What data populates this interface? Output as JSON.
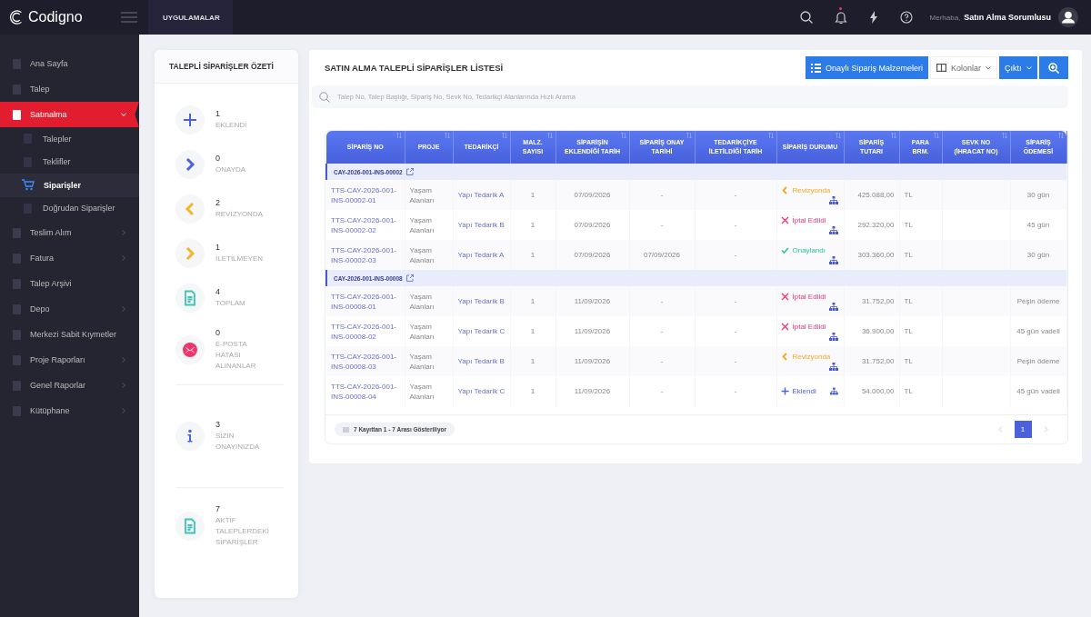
{
  "topbar": {
    "brand": "Codigno",
    "apps_label": "UYGULAMALAR",
    "greeting": "Merhaba,",
    "user_name": "Satın Alma Sorumlusu",
    "notification_dot": true
  },
  "sidebar": {
    "items": [
      {
        "label": "Ana Sayfa",
        "selected": false
      },
      {
        "label": "Talep",
        "selected": false
      },
      {
        "label": "Satınalma",
        "selected": true,
        "expanded": true,
        "children": [
          {
            "label": "Talepler",
            "selected": false
          },
          {
            "label": "Teklifler",
            "selected": false
          },
          {
            "label": "Siparişler",
            "selected": true
          },
          {
            "label": "Doğrudan Siparişler",
            "selected": false
          }
        ]
      },
      {
        "label": "Teslim Alım",
        "selected": false,
        "expanded": false
      },
      {
        "label": "Fatura",
        "selected": false,
        "expanded": false
      },
      {
        "label": "Talep Arşivi",
        "selected": false
      },
      {
        "label": "Depo",
        "selected": false,
        "expanded": false
      },
      {
        "label": "Merkezi Sabit Kıymetler",
        "selected": false
      },
      {
        "label": "Proje Raporları",
        "selected": false,
        "expanded": false
      },
      {
        "label": "Genel Raporlar",
        "selected": false,
        "expanded": false
      },
      {
        "label": "Kütüphane",
        "selected": false,
        "expanded": false
      }
    ]
  },
  "summary": {
    "title": "TALEPLİ SİPARİŞLER ÖZETİ",
    "groups": [
      [
        {
          "count": "1",
          "label": "EKLENDİ",
          "kind": "plus",
          "color": "#4a63e0"
        },
        {
          "count": "0",
          "label": "ONAYDA",
          "kind": "right",
          "color": "#4a63e0"
        },
        {
          "count": "2",
          "label": "REVİZYONDA",
          "kind": "left",
          "color": "#f5b52a"
        },
        {
          "count": "1",
          "label": "İLETİLMEYEN",
          "kind": "right",
          "color": "#f5b52a"
        },
        {
          "count": "4",
          "label": "TOPLAM",
          "kind": "doc",
          "color": "#3cc4b5"
        },
        {
          "count": "0",
          "label": "E-POSTA HATASI ALINANLAR",
          "kind": "mail",
          "color": "#f0346e"
        }
      ],
      [
        {
          "count": "3",
          "label": "SİZİN ONAYINIZDA",
          "kind": "info",
          "color": "#4a63e0"
        }
      ],
      [
        {
          "count": "7",
          "label": "AKTİF TALEPLERDEKİ SİPARİŞLER",
          "kind": "doc",
          "color": "#3cc4b5"
        }
      ]
    ]
  },
  "orders": {
    "title": "SATIN ALMA TALEPLİ SİPARİŞLER LİSTESİ",
    "buttons": [
      {
        "label": "Onaylı Sipariş Malzemeleri",
        "kind": "list"
      },
      {
        "label": "Kolonlar",
        "kind": "columns"
      },
      {
        "label": "Çıktı",
        "kind": "dropdown"
      },
      {
        "kind": "zoom"
      }
    ],
    "search": {
      "placeholder": "Talep No, Talep Başlığı, Sipariş No, Sevk No, Tedarikçi Alanlarında Hızlı Arama"
    },
    "table": {
      "columns": [
        "SİPARİŞ NO",
        "PROJE",
        "TEDARİKÇİ",
        "MALZ. SAYISI",
        "SİPARİŞİN EKLENDİĞİ TARİH",
        "SİPARİŞ ONAY TARİHİ",
        "TEDARİKÇİYE İLETİLDİĞİ TARİH",
        "SİPARİŞ DURUMU",
        "SİPARİŞ TUTARI",
        "PARA BRM.",
        "SEVK NO (İHRACAT NO)",
        "SİPARİŞ ÖDEMESİ"
      ],
      "groups": [
        {
          "code": "CAY-2026-001-INS-00002",
          "rows": [
            {
              "order_no": "TTS-CAY-2026-001-INS-00002-01",
              "project": "Yaşam Alanları",
              "supplier": "Yapı Tedarik A",
              "quantity": "1",
              "added_date": "07/09/2026",
              "approval_date": "-",
              "sent_date": "-",
              "status": {
                "kind": "revision",
                "label": "Revizyonda"
              },
              "amount": "425.088,00",
              "currency": "TL",
              "payment": "30 gün"
            },
            {
              "order_no": "TTS-CAY-2026-001-INS-00002-02",
              "project": "Yaşam Alanları",
              "supplier": "Yapı Tedarik B",
              "quantity": "1",
              "added_date": "07/09/2026",
              "approval_date": "-",
              "sent_date": "-",
              "status": {
                "kind": "cancelled",
                "label": "İptal Edildi"
              },
              "amount": "292.320,00",
              "currency": "TL",
              "payment": "45 gün"
            },
            {
              "order_no": "TTS-CAY-2026-001-INS-00002-03",
              "project": "Yaşam Alanları",
              "supplier": "Yapı Tedarik A",
              "quantity": "1",
              "added_date": "07/09/2026",
              "approval_date": "07/09/2026",
              "sent_date": "-",
              "status": {
                "kind": "approved",
                "label": "Onaylandı"
              },
              "amount": "303.360,00",
              "currency": "TL",
              "payment": "30 gün"
            }
          ]
        },
        {
          "code": "CAY-2026-001-INS-00008",
          "rows": [
            {
              "order_no": "TTS-CAY-2026-001-INS-00008-01",
              "project": "Yaşam Alanları",
              "supplier": "Yapı Tedarik B",
              "quantity": "1",
              "added_date": "11/09/2026",
              "approval_date": "-",
              "sent_date": "-",
              "status": {
                "kind": "cancelled",
                "label": "İptal Edildi"
              },
              "amount": "31.752,00",
              "currency": "TL",
              "payment": "Peşin ödeme"
            },
            {
              "order_no": "TTS-CAY-2026-001-INS-00008-02",
              "project": "Yaşam Alanları",
              "supplier": "Yapı Tedarik C",
              "quantity": "1",
              "added_date": "11/09/2026",
              "approval_date": "-",
              "sent_date": "-",
              "status": {
                "kind": "cancelled",
                "label": "İptal Edildi"
              },
              "amount": "36.900,00",
              "currency": "TL",
              "payment": "45 gün vadeli"
            },
            {
              "order_no": "TTS-CAY-2026-001-INS-00008-03",
              "project": "Yaşam Alanları",
              "supplier": "Yapı Tedarik B",
              "quantity": "1",
              "added_date": "11/09/2026",
              "approval_date": "-",
              "sent_date": "-",
              "status": {
                "kind": "revision",
                "label": "Revizyonda"
              },
              "amount": "31.752,00",
              "currency": "TL",
              "payment": "Peşin ödeme"
            },
            {
              "order_no": "TTS-CAY-2026-001-INS-00008-04",
              "project": "Yaşam Alanları",
              "supplier": "Yapı Tedarik C",
              "quantity": "1",
              "added_date": "11/09/2026",
              "approval_date": "-",
              "sent_date": "-",
              "status": {
                "kind": "added",
                "label": "Eklendi"
              },
              "amount": "54.000,00",
              "currency": "TL",
              "payment": "45 gün vadeli"
            }
          ]
        }
      ]
    },
    "record_info": "7 Kayıttan 1 - 7 Arası Gösteriliyor",
    "pages": [
      {
        "label": "1",
        "selected": true
      }
    ]
  }
}
